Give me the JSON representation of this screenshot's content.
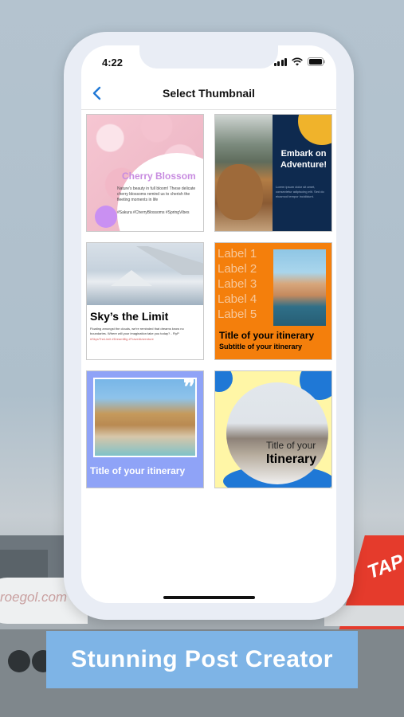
{
  "background": {
    "plane_text_left": "roegol.com",
    "plane_tail_text": "TAP"
  },
  "status_bar": {
    "time": "4:22"
  },
  "nav": {
    "back_icon": "chevron-left-icon",
    "title": "Select Thumbnail"
  },
  "thumbnails": [
    {
      "title": "Cherry Blossom",
      "body": "Nature's beauty in full bloom! These delicate cherry blossoms remind us to cherish the fleeting moments in life",
      "tags": "#Sakura #CherryBlossoms #SpringVibes"
    },
    {
      "title": "Embark on Adventure!",
      "body": "Lorem ipsum dolor sit amet, consectetur adipiscing elit. Sed do eiusmod tempor incididunt."
    },
    {
      "title": "Sky’s the Limit",
      "body": "Floating amongst the clouds, we're reminded that dreams know no boundaries. Where will your imagination take you today? - FlyP",
      "tags": "#SkysTheLimit #DreamBig #TravelAdventure"
    },
    {
      "labels": [
        "Label 1",
        "Label 2",
        "Label 3",
        "Label 4",
        "Label 5"
      ],
      "title": "Title of your itinerary",
      "subtitle": "Subtitle of your itinerary"
    },
    {
      "quote_mark": "❞",
      "title": "Title of your itinerary"
    },
    {
      "title_line1": "Title of your",
      "title_line2": "Itinerary"
    }
  ],
  "banner": {
    "text": "Stunning Post Creator"
  },
  "colors": {
    "accent_blue": "#1f78d6",
    "banner_blue": "#7eb4e6",
    "orange": "#f47f0c",
    "navy": "#0e2a4f",
    "periwinkle": "#8fa3f7",
    "cherry_purple": "#c88ce0"
  }
}
